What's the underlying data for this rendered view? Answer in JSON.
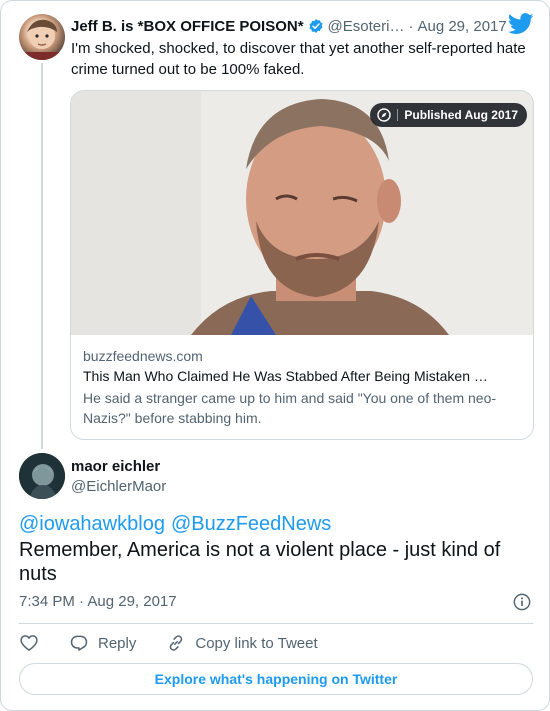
{
  "quoted_tweet": {
    "author_name": "Jeff B. is *BOX OFFICE POISON*",
    "author_handle": "@Esoteri…",
    "separator": "·",
    "date": "Aug 29, 2017",
    "text": "I'm shocked, shocked, to discover that yet another self-reported hate crime turned out to be 100% faked.",
    "link_card": {
      "badge": "Published Aug 2017",
      "domain": "buzzfeednews.com",
      "title": "This Man Who Claimed He Was Stabbed After Being Mistaken …",
      "description": "He said a stranger came up to him and said \"You one of them neo-Nazis?\" before stabbing him."
    }
  },
  "tweet": {
    "author_name": "maor eichler",
    "author_handle": "@EichlerMaor",
    "mentions": [
      "@iowahawkblog",
      "@BuzzFeedNews"
    ],
    "text": "Remember, America is not a violent place - just kind of nuts",
    "timestamp": "7:34 PM · Aug 29, 2017"
  },
  "actions": {
    "reply_label": "Reply",
    "copy_link_label": "Copy link to Tweet"
  },
  "explore_label": "Explore what's happening on Twitter",
  "icons": [
    "verified-badge-icon",
    "twitter-bird-icon",
    "compass-icon",
    "info-icon",
    "heart-icon",
    "reply-icon",
    "link-icon"
  ],
  "colors": {
    "accent": "#1d9bf0",
    "muted": "#536471",
    "border": "#cfd9de"
  }
}
